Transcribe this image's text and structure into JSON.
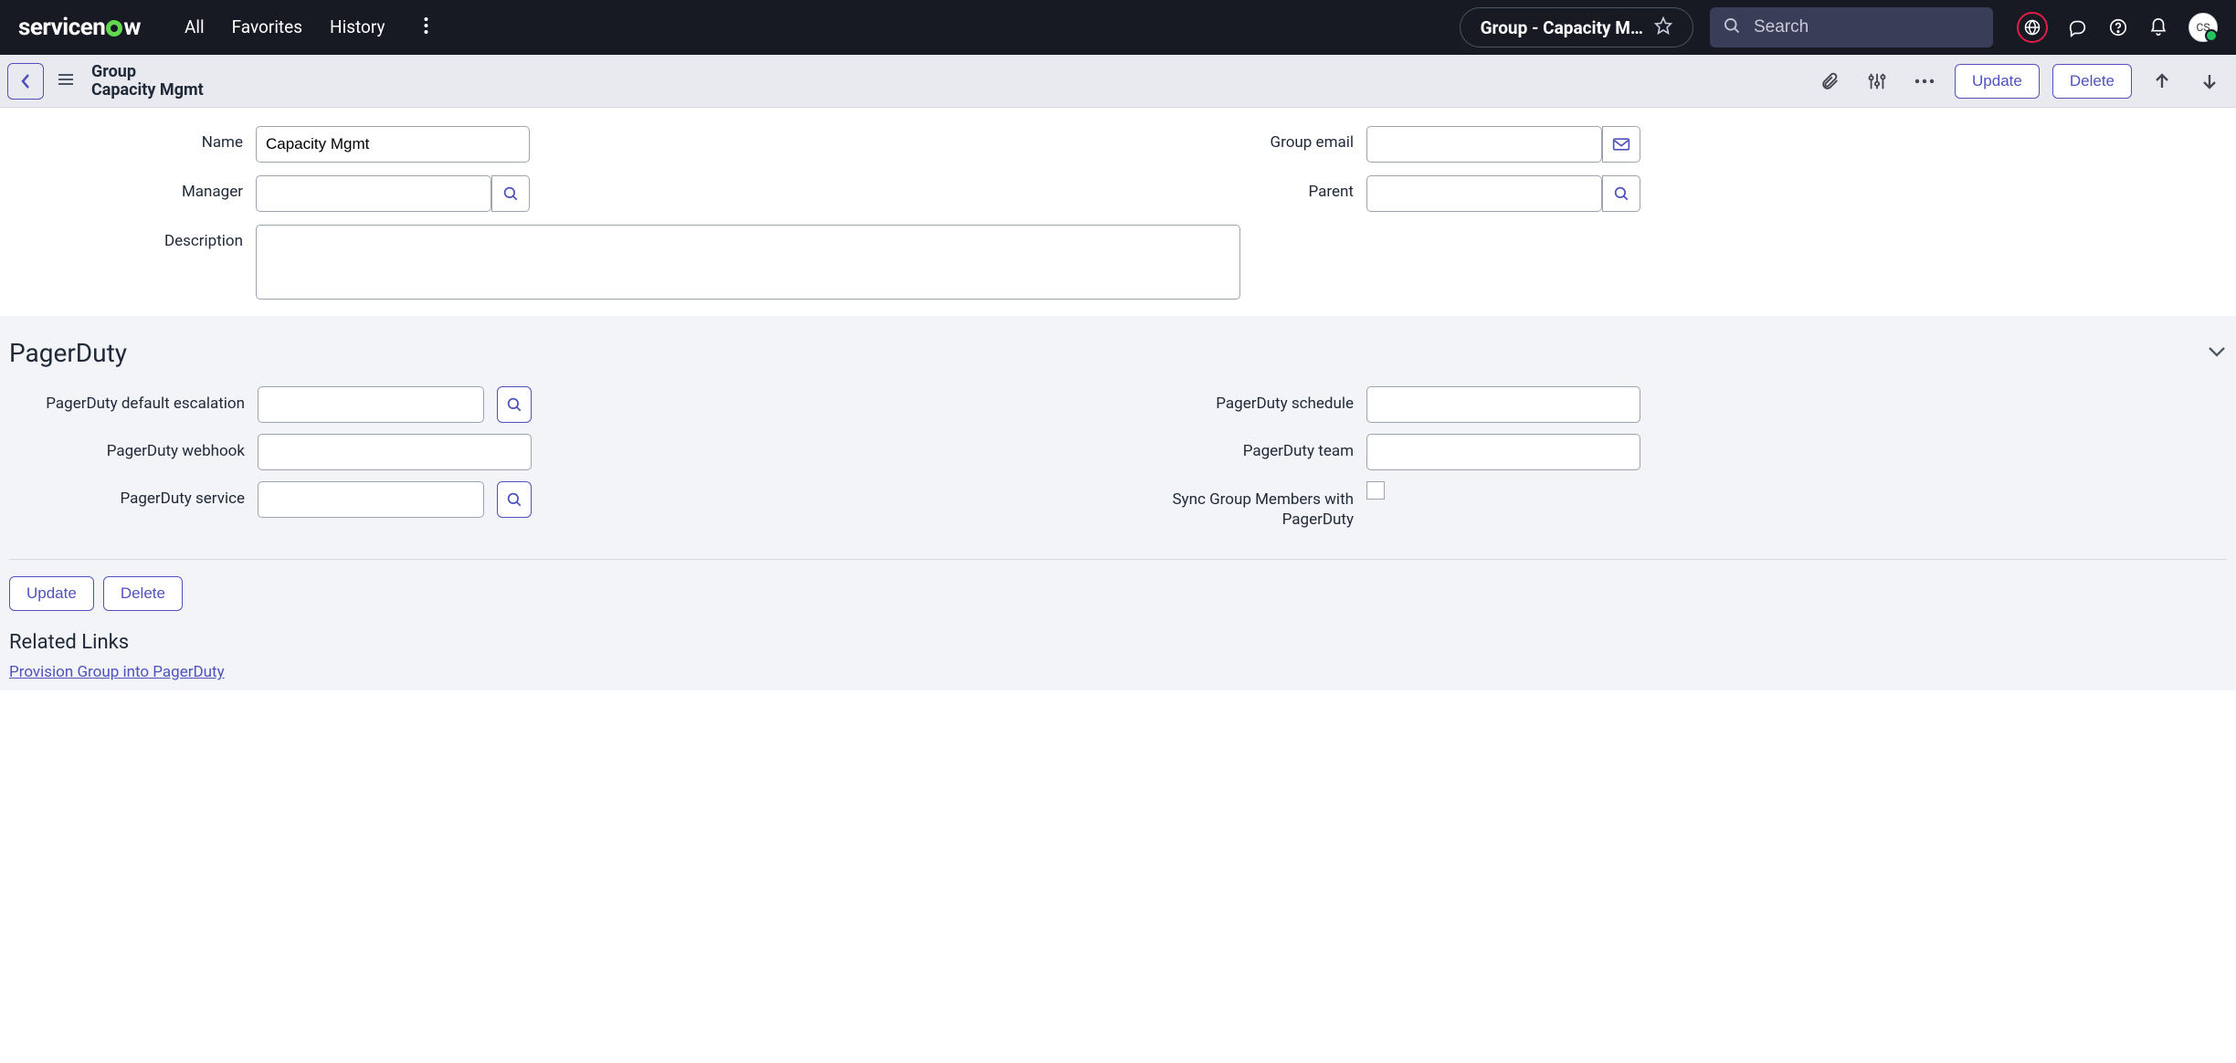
{
  "banner": {
    "logo_text_left": "servicen",
    "logo_text_right": "w",
    "nav": {
      "all": "All",
      "favorites": "Favorites",
      "history": "History"
    },
    "pill_title": "Group - Capacity M…",
    "search_placeholder": "Search",
    "avatar_initials": "CS"
  },
  "formbar": {
    "title_line1": "Group",
    "title_line2": "Capacity Mgmt",
    "update": "Update",
    "delete": "Delete"
  },
  "form": {
    "labels": {
      "name": "Name",
      "manager": "Manager",
      "group_email": "Group email",
      "parent": "Parent",
      "description": "Description"
    },
    "values": {
      "name": "Capacity Mgmt",
      "manager": "",
      "group_email": "",
      "parent": "",
      "description": ""
    }
  },
  "pagerduty": {
    "section_title": "PagerDuty",
    "labels": {
      "default_escalation": "PagerDuty default escalation",
      "webhook": "PagerDuty webhook",
      "service": "PagerDuty service",
      "schedule": "PagerDuty schedule",
      "team": "PagerDuty team",
      "sync": "Sync Group Members with PagerDuty"
    },
    "values": {
      "default_escalation": "",
      "webhook": "",
      "service": "",
      "schedule": "",
      "team": "",
      "sync": false
    }
  },
  "bottom": {
    "update": "Update",
    "delete": "Delete",
    "related_links_title": "Related Links",
    "provision_link": "Provision Group into PagerDuty"
  }
}
